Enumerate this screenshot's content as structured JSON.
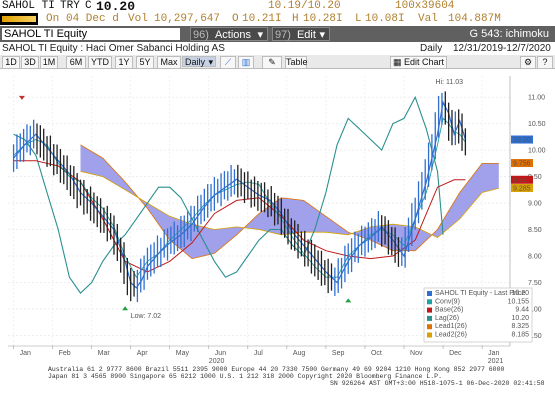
{
  "header": {
    "ticker": "SAHOL TI",
    "currency": "TRY",
    "price_prefix": "C",
    "last_price": "10.20",
    "bid_ask": "10.19/10.20",
    "bid_ask_size": "100x39604",
    "on_label": "On",
    "date": "04 Dec d",
    "vol_label": "Vol",
    "volume": "10,297,647",
    "open_label": "O",
    "open": "10.21I",
    "high_label": "H",
    "high": "10.28I",
    "low_label": "L",
    "low": "10.08I",
    "val_label": "Val",
    "value": "104.887M"
  },
  "toolbar": {
    "security_field": "SAHOL TI Equity",
    "actions_num": "96)",
    "actions_label": "Actions",
    "edit_num": "97)",
    "edit_label": "Edit",
    "function_name": "G 543: ichimoku"
  },
  "info": {
    "title": "SAHOL TI Equity : Haci Omer Sabanci Holding AS",
    "period": "Daily",
    "range": "12/31/2019-12/7/2020"
  },
  "range_buttons": [
    "1D",
    "3D",
    "1M",
    "6M",
    "YTD",
    "1Y",
    "5Y",
    "Max"
  ],
  "frequency": "Daily",
  "table_label": "Table",
  "edit_chart_label": "Edit Chart",
  "colors": {
    "cloud": "#8f8fe8",
    "conversion": "#20a0a0",
    "base": "#c01818",
    "lagging": "#2a8f8f",
    "lead1": "#e07000",
    "lead2": "#d8a000",
    "candles": "#2f6fd0",
    "candles_down": "#202020"
  },
  "chart_data": {
    "type": "line",
    "y_ticks": [
      "11.00",
      "10.50",
      "10.00",
      "9.50",
      "9.00",
      "8.50",
      "8.00",
      "7.50",
      "7.00",
      "6.50"
    ],
    "ylim": [
      6.3,
      11.4
    ],
    "x_ticks": [
      "Jan",
      "Feb",
      "Mar",
      "Apr",
      "May",
      "Jun",
      "Jul",
      "Aug",
      "Sep",
      "Oct",
      "Nov",
      "Dec",
      "Jan"
    ],
    "year_labels": [
      "2020",
      "2021"
    ],
    "annotations": {
      "high": "Hi: 11.03",
      "low": "Low: 7.02"
    },
    "price_labels": [
      "10.20",
      "9.756",
      "9.44",
      "9.285"
    ],
    "legend": [
      {
        "name": "SAHOL TI Equity - Last Price",
        "value": "10.20",
        "color": "#2f6fd0"
      },
      {
        "name": "Conv(9)",
        "value": "10.155",
        "color": "#20a0a0"
      },
      {
        "name": "Base(26)",
        "value": "9.44",
        "color": "#c01818"
      },
      {
        "name": "Lag(26)",
        "value": "10.20",
        "color": "#2a8f8f"
      },
      {
        "name": "Lead1(26)",
        "value": "8.325",
        "color": "#e07000"
      },
      {
        "name": "Lead2(26)",
        "value": "8.185",
        "color": "#d8a000"
      }
    ],
    "price": [
      [
        1,
        9.85
      ],
      [
        3,
        10.1
      ],
      [
        5,
        10.3
      ],
      [
        7,
        10.05
      ],
      [
        9,
        9.8
      ],
      [
        11,
        9.55
      ],
      [
        13,
        9.2
      ],
      [
        15,
        9.0
      ],
      [
        17,
        8.75
      ],
      [
        19,
        8.5
      ],
      [
        21,
        7.9
      ],
      [
        22,
        7.5
      ],
      [
        23,
        7.4
      ],
      [
        24,
        7.55
      ],
      [
        25,
        7.8
      ],
      [
        27,
        8.05
      ],
      [
        29,
        8.25
      ],
      [
        31,
        8.4
      ],
      [
        33,
        8.6
      ],
      [
        35,
        8.9
      ],
      [
        37,
        9.15
      ],
      [
        39,
        9.3
      ],
      [
        41,
        9.45
      ],
      [
        43,
        9.3
      ],
      [
        45,
        9.15
      ],
      [
        47,
        9.05
      ],
      [
        49,
        8.8
      ],
      [
        51,
        8.45
      ],
      [
        53,
        8.2
      ],
      [
        55,
        7.95
      ],
      [
        57,
        7.7
      ],
      [
        59,
        7.5
      ],
      [
        61,
        7.9
      ],
      [
        63,
        8.2
      ],
      [
        65,
        8.35
      ],
      [
        67,
        8.55
      ],
      [
        69,
        8.3
      ],
      [
        71,
        8.0
      ],
      [
        73,
        8.7
      ],
      [
        75,
        9.4
      ],
      [
        77,
        10.3
      ],
      [
        78,
        10.9
      ],
      [
        79,
        10.7
      ],
      [
        80,
        10.3
      ],
      [
        81,
        10.55
      ],
      [
        82,
        10.2
      ]
    ],
    "conversion": [
      [
        1,
        9.9
      ],
      [
        3,
        10.1
      ],
      [
        5,
        10.2
      ],
      [
        7,
        10.1
      ],
      [
        9,
        9.75
      ],
      [
        11,
        9.5
      ],
      [
        13,
        9.4
      ],
      [
        15,
        9.1
      ],
      [
        17,
        8.9
      ],
      [
        19,
        8.55
      ],
      [
        21,
        8.0
      ],
      [
        23,
        7.6
      ],
      [
        25,
        7.9
      ],
      [
        27,
        8.05
      ],
      [
        29,
        8.3
      ],
      [
        31,
        8.5
      ],
      [
        33,
        8.7
      ],
      [
        35,
        8.95
      ],
      [
        37,
        9.15
      ],
      [
        39,
        9.25
      ],
      [
        41,
        9.35
      ],
      [
        43,
        9.4
      ],
      [
        45,
        9.35
      ],
      [
        47,
        9.0
      ],
      [
        49,
        8.7
      ],
      [
        51,
        8.35
      ],
      [
        53,
        8.05
      ],
      [
        55,
        7.8
      ],
      [
        57,
        7.6
      ],
      [
        59,
        7.6
      ],
      [
        61,
        8.0
      ],
      [
        63,
        8.2
      ],
      [
        65,
        8.4
      ],
      [
        67,
        8.5
      ],
      [
        69,
        8.4
      ],
      [
        71,
        8.2
      ],
      [
        73,
        8.7
      ],
      [
        75,
        9.2
      ],
      [
        77,
        10.1
      ],
      [
        78,
        10.6
      ],
      [
        79,
        10.5
      ],
      [
        80,
        10.35
      ],
      [
        81,
        10.3
      ],
      [
        82,
        10.15
      ]
    ],
    "base": [
      [
        1,
        9.8
      ],
      [
        5,
        9.8
      ],
      [
        9,
        9.7
      ],
      [
        13,
        9.4
      ],
      [
        17,
        8.7
      ],
      [
        21,
        7.9
      ],
      [
        25,
        7.7
      ],
      [
        29,
        7.9
      ],
      [
        33,
        8.25
      ],
      [
        37,
        8.8
      ],
      [
        41,
        9.05
      ],
      [
        45,
        9.1
      ],
      [
        49,
        8.75
      ],
      [
        53,
        8.3
      ],
      [
        57,
        8.1
      ],
      [
        61,
        8.0
      ],
      [
        65,
        7.95
      ],
      [
        69,
        8.0
      ],
      [
        73,
        8.3
      ],
      [
        77,
        9.3
      ],
      [
        80,
        9.44
      ],
      [
        82,
        9.44
      ]
    ],
    "lagging": [
      [
        1,
        10.3
      ],
      [
        3,
        10.2
      ],
      [
        5,
        9.9
      ],
      [
        7,
        9.2
      ],
      [
        9,
        8.5
      ],
      [
        11,
        7.6
      ],
      [
        13,
        7.3
      ],
      [
        15,
        7.5
      ],
      [
        17,
        7.9
      ],
      [
        19,
        8.2
      ],
      [
        21,
        8.4
      ],
      [
        23,
        8.7
      ],
      [
        25,
        9.0
      ],
      [
        27,
        9.3
      ],
      [
        29,
        9.3
      ],
      [
        31,
        9.1
      ],
      [
        33,
        8.7
      ],
      [
        35,
        8.3
      ],
      [
        37,
        7.9
      ],
      [
        39,
        7.6
      ],
      [
        41,
        7.7
      ],
      [
        43,
        8.0
      ],
      [
        45,
        8.3
      ],
      [
        47,
        8.5
      ],
      [
        49,
        8.5
      ],
      [
        51,
        8.2
      ],
      [
        53,
        8.0
      ],
      [
        55,
        8.5
      ],
      [
        57,
        9.2
      ],
      [
        59,
        10.1
      ],
      [
        61,
        10.6
      ],
      [
        63,
        10.4
      ],
      [
        65,
        10.2
      ],
      [
        67,
        10.0
      ],
      [
        69,
        10.5
      ],
      [
        71,
        10.6
      ],
      [
        73,
        11.0
      ],
      [
        75,
        10.4
      ],
      [
        77,
        9.6
      ],
      [
        78,
        8.4
      ]
    ],
    "lead1": [
      [
        13,
        10.1
      ],
      [
        17,
        9.85
      ],
      [
        21,
        9.4
      ],
      [
        25,
        8.9
      ],
      [
        29,
        8.3
      ],
      [
        33,
        7.95
      ],
      [
        37,
        8.05
      ],
      [
        41,
        8.4
      ],
      [
        45,
        8.8
      ],
      [
        49,
        9.1
      ],
      [
        53,
        9.05
      ],
      [
        57,
        8.75
      ],
      [
        61,
        8.45
      ],
      [
        65,
        8.3
      ],
      [
        69,
        8.1
      ],
      [
        73,
        8.1
      ],
      [
        77,
        8.5
      ],
      [
        81,
        9.2
      ],
      [
        85,
        9.75
      ],
      [
        88,
        9.75
      ]
    ],
    "lead2": [
      [
        13,
        9.6
      ],
      [
        17,
        9.5
      ],
      [
        21,
        9.25
      ],
      [
        25,
        9.0
      ],
      [
        29,
        8.75
      ],
      [
        33,
        8.6
      ],
      [
        37,
        8.5
      ],
      [
        41,
        8.55
      ],
      [
        45,
        8.5
      ],
      [
        49,
        8.4
      ],
      [
        53,
        8.45
      ],
      [
        57,
        8.45
      ],
      [
        61,
        8.4
      ],
      [
        65,
        8.55
      ],
      [
        69,
        8.6
      ],
      [
        73,
        8.55
      ],
      [
        77,
        8.35
      ],
      [
        81,
        8.7
      ],
      [
        85,
        9.2
      ],
      [
        88,
        9.28
      ]
    ]
  },
  "footer": {
    "line1": "Australia 61 2 9777 8600 Brazil 5511 2395 9000 Europe 44 20 7330 7500 Germany 49 69 9204 1210 Hong Kong 852 2977 6000",
    "line2": "Japan 81 3 4565 8900       Singapore 65 6212 1000       U.S. 1 212 318 2000          Copyright 2020 Bloomberg Finance L.P.",
    "line3": "SN 926264 AST  GMT+3:00 H518-1075-1 06-Dec-2020 02:41:58"
  }
}
